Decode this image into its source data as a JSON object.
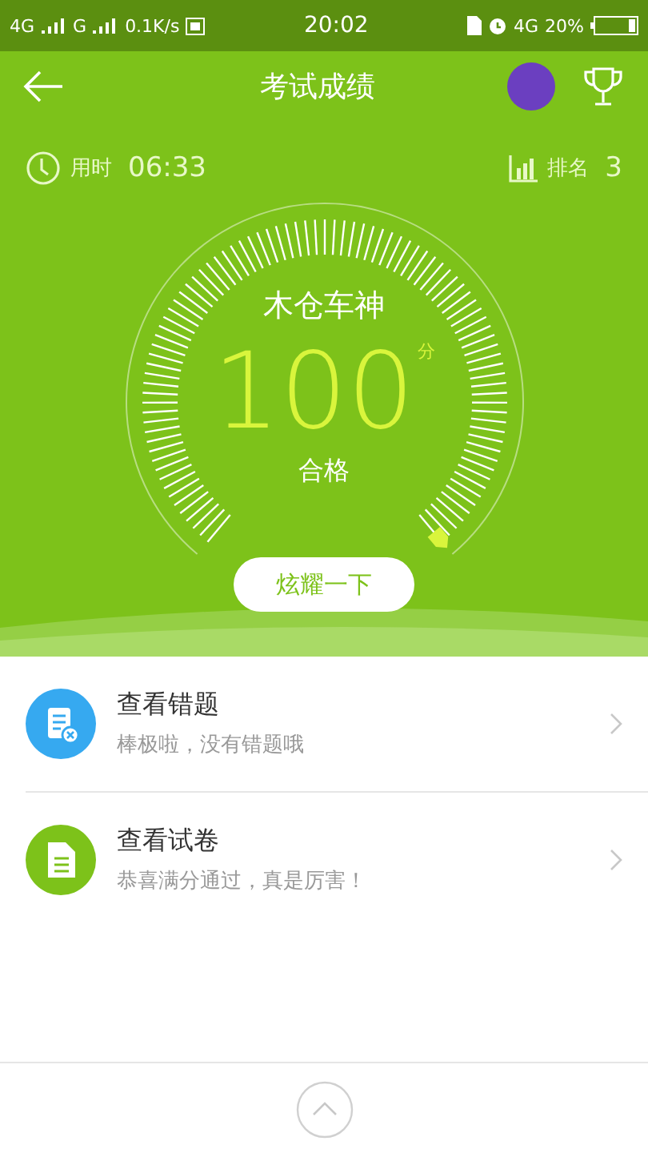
{
  "status_bar": {
    "network_1": "4G",
    "network_2": "G",
    "speed": "0.1K/s",
    "time": "20:02",
    "network_3": "4G",
    "battery": "20%"
  },
  "header": {
    "title": "考试成绩"
  },
  "stats": {
    "time_label": "用时",
    "time_value": "06:33",
    "rank_label": "排名",
    "rank_value": "3"
  },
  "gauge": {
    "name": "木仓车神",
    "score": "100",
    "unit": "分",
    "result": "合格"
  },
  "share_button": "炫耀一下",
  "items": [
    {
      "kind": "wrong",
      "title": "查看错题",
      "subtitle": "棒极啦，没有错题哦"
    },
    {
      "kind": "paper",
      "title": "查看试卷",
      "subtitle": "恭喜满分通过，真是厉害！"
    }
  ]
}
